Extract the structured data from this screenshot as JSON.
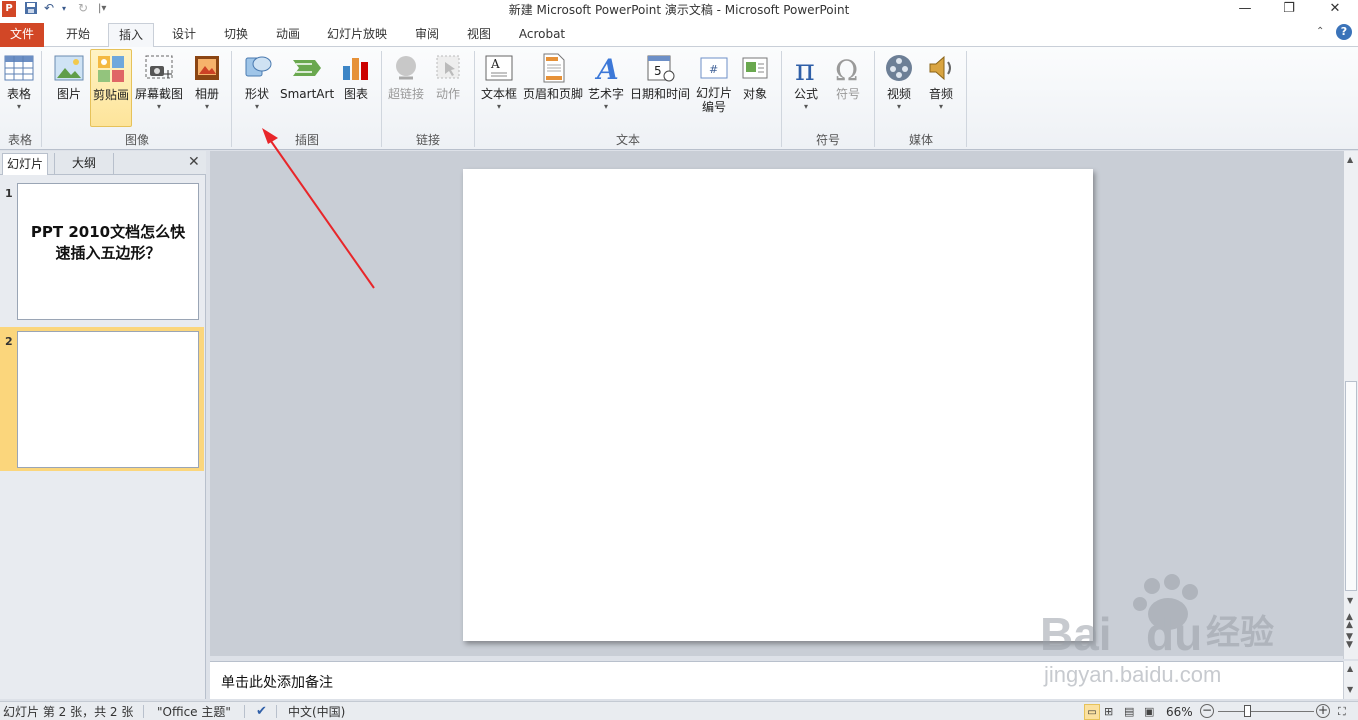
{
  "window": {
    "title": "新建 Microsoft PowerPoint 演示文稿 - Microsoft PowerPoint",
    "minimize": "—",
    "restore": "❐",
    "close": "✕"
  },
  "tabs": [
    {
      "label": "文件"
    },
    {
      "label": "开始"
    },
    {
      "label": "插入"
    },
    {
      "label": "设计"
    },
    {
      "label": "切换"
    },
    {
      "label": "动画"
    },
    {
      "label": "幻灯片放映"
    },
    {
      "label": "审阅"
    },
    {
      "label": "视图"
    },
    {
      "label": "Acrobat"
    }
  ],
  "ribbon": {
    "groups": {
      "table": "表格",
      "images": "图像",
      "illustrations": "插图",
      "links": "链接",
      "text": "文本",
      "symbols": "符号",
      "media": "媒体"
    },
    "buttons": {
      "table": "表格",
      "picture": "图片",
      "clipart": "剪贴画",
      "screenshot": "屏幕截图",
      "album": "相册",
      "shapes": "形状",
      "smartart": "SmartArt",
      "chart": "图表",
      "hyperlink": "超链接",
      "action": "动作",
      "textbox": "文本框",
      "header_footer": "页眉和页脚",
      "wordart": "艺术字",
      "datetime": "日期和时间",
      "slide_number_1": "幻灯片",
      "slide_number_2": "编号",
      "object": "对象",
      "equation": "公式",
      "symbol": "符号",
      "video": "视频",
      "audio": "音频"
    }
  },
  "panel": {
    "tab_slides": "幻灯片",
    "tab_outline": "大纲",
    "close": "✕"
  },
  "slides": [
    {
      "number": "1",
      "title_line1": "PPT 2010文档怎么快",
      "title_line2": "速插入五边形？"
    },
    {
      "number": "2"
    }
  ],
  "notes": {
    "placeholder": "单击此处添加备注"
  },
  "status": {
    "slide_info": "幻灯片 第 2 张，共 2 张",
    "theme": "\"Office 主题\"",
    "language": "中文(中国)",
    "zoom": "66%"
  },
  "watermark": {
    "brand": "Bai",
    "brand2": "du",
    "cn": "经验",
    "url": "jingyan.baidu.com"
  },
  "annotation": {
    "color": "#e8262a"
  },
  "colors": {
    "file_tab": "#d24726",
    "selected_slide": "#fbd67c"
  }
}
